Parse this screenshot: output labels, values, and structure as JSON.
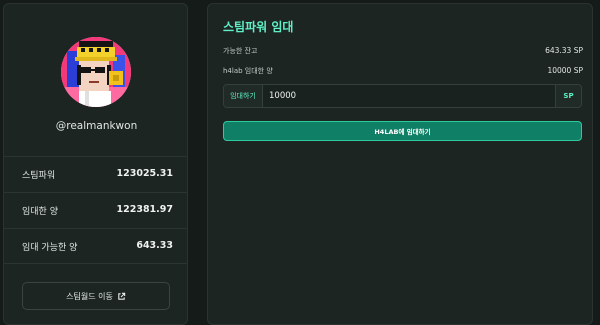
{
  "profile": {
    "username": "@realmankwon",
    "avatar_icon": "pixel-avatar-icon",
    "stats": [
      {
        "label": "스팀파워",
        "value": "123025.31"
      },
      {
        "label": "임대한 양",
        "value": "122381.97"
      },
      {
        "label": "임대 가능한 양",
        "value": "643.33"
      }
    ],
    "wiki_button": {
      "label": "스팀월드 이동",
      "icon": "external-link-icon"
    }
  },
  "lease": {
    "title": "스팀파워 임대",
    "available_balance": {
      "label": "가능한 잔고",
      "value": "643.33 SP"
    },
    "h4lab_leased": {
      "label": "h4lab 임대한 양",
      "value": "10000 SP"
    },
    "input": {
      "prefix": "임대하기",
      "value": "10000",
      "suffix": "SP"
    },
    "submit_label": "H4LAB에 임대하기"
  },
  "colors": {
    "accent": "#5ff0c5",
    "button_bg": "#0f7f65",
    "card_bg": "#1d2523",
    "page_bg": "#151b19"
  }
}
